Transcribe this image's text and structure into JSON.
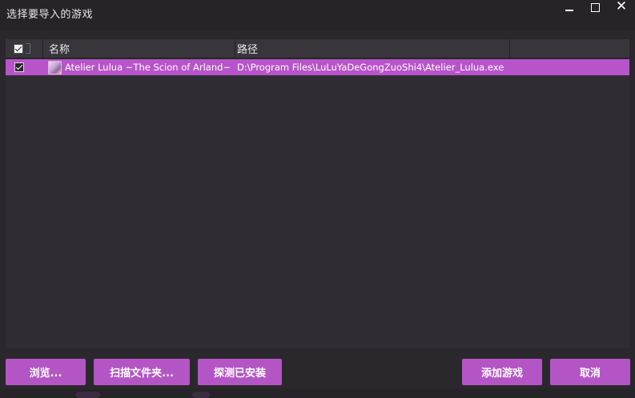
{
  "window": {
    "title": "选择要导入的游戏",
    "controls": {
      "minimize": "minimize",
      "maximize": "maximize",
      "close": "✕"
    }
  },
  "table": {
    "columns": {
      "name": "名称",
      "path": "路径"
    },
    "rows": [
      {
        "checked": true,
        "name": "Atelier Lulua ~The Scion of Arland~",
        "path": "D:\\Program Files\\LuLuYaDeGongZuoShi4\\Atelier_Lulua.exe"
      }
    ]
  },
  "buttons": {
    "browse": "浏览...",
    "scan_folder": "扫描文件夹...",
    "detect_installed": "探测已安装",
    "add_games": "添加游戏",
    "cancel": "取消"
  },
  "colors": {
    "accent": "#b455c6",
    "selected_row": "#b754c9",
    "background": "#2a282c"
  }
}
